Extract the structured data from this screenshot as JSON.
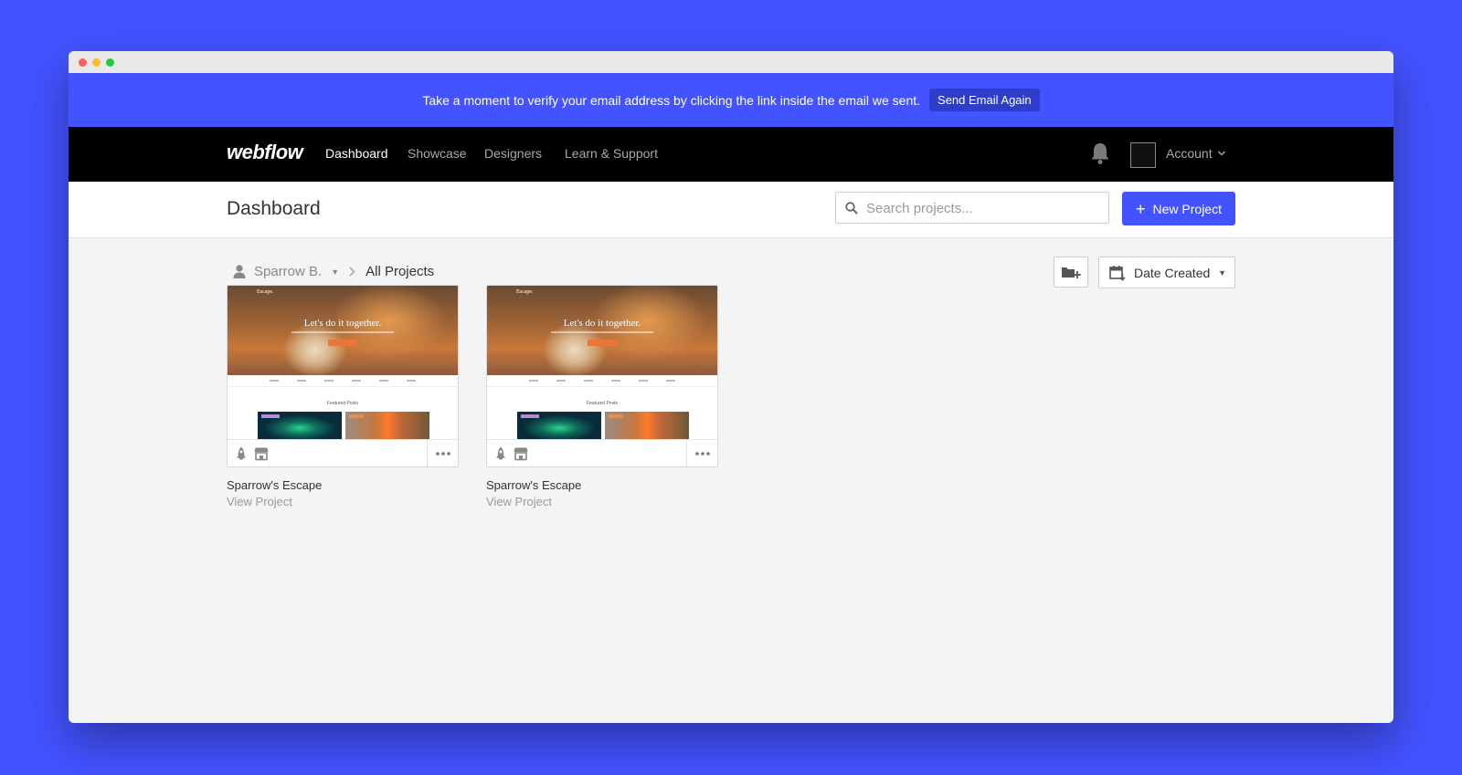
{
  "banner": {
    "message": "Take a moment to verify your email address by clicking the link inside the email we sent.",
    "button_label": "Send Email Again"
  },
  "nav": {
    "logo": "webflow",
    "links": [
      {
        "label": "Dashboard",
        "active": true
      },
      {
        "label": "Showcase",
        "active": false
      },
      {
        "label": "Designers",
        "active": false
      },
      {
        "label": "Learn & Support",
        "active": false
      }
    ],
    "account_label": "Account"
  },
  "header": {
    "title": "Dashboard",
    "search_placeholder": "Search projects...",
    "new_project_label": "New Project"
  },
  "toolbar": {
    "breadcrumb_user": "Sparrow B.",
    "breadcrumb_current": "All Projects",
    "sort_label": "Date Created"
  },
  "projects": [
    {
      "name": "Sparrow's Escape",
      "link_label": "View Project",
      "thumbnail": {
        "brand": "Escape.",
        "headline": "Let's do it together.",
        "section": "Featured Posts"
      }
    },
    {
      "name": "Sparrow's Escape",
      "link_label": "View Project",
      "thumbnail": {
        "brand": "Escape.",
        "headline": "Let's do it together.",
        "section": "Featured Posts"
      }
    }
  ],
  "colors": {
    "brand": "#4353ff",
    "nav_bg": "#000000",
    "page_bg": "#f4f4f4"
  },
  "icons": [
    "bell-icon",
    "search-icon",
    "plus-icon",
    "user-icon",
    "chevron-right-icon",
    "new-folder-icon",
    "calendar-icon",
    "rocket-icon",
    "store-icon",
    "more-icon"
  ]
}
